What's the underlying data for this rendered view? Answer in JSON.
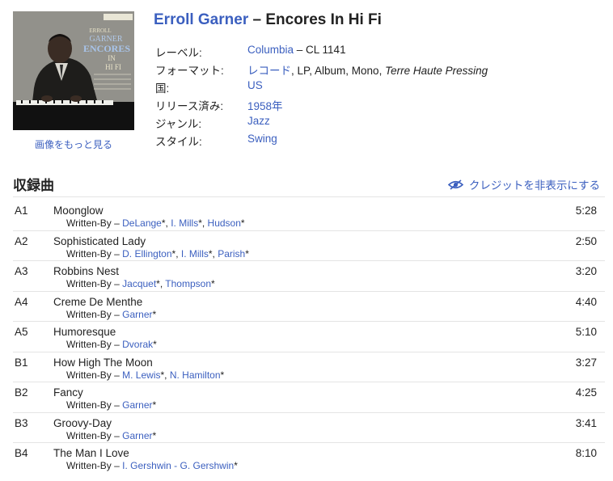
{
  "release": {
    "artist": "Erroll Garner",
    "separator": " – ",
    "album": "Encores In Hi Fi"
  },
  "cover": {
    "more_images": "画像をもっと見る",
    "text_lines": [
      "ERROLL",
      "GARNER",
      "ENCORES",
      "IN",
      "HI FI"
    ]
  },
  "info": {
    "label": {
      "label": "レーベル:",
      "link": "Columbia",
      "rest": " – CL 1141"
    },
    "format": {
      "label": "フォーマット:",
      "link": "レコード",
      "rest": ", LP, Album, Mono, ",
      "italic": "Terre Haute Pressing"
    },
    "country": {
      "label": "国:",
      "link": "US"
    },
    "released": {
      "label": "リリース済み:",
      "link": "1958年"
    },
    "genre": {
      "label": "ジャンル:",
      "link": "Jazz"
    },
    "style": {
      "label": "スタイル:",
      "link": "Swing"
    }
  },
  "tracklist": {
    "heading": "収録曲",
    "toggle_credits": "クレジットを非表示にする",
    "credit_prefix": "Written-By – ",
    "tracks": [
      {
        "pos": "A1",
        "title": "Moonglow",
        "writers": [
          "DeLange",
          "I. Mills",
          "Hudson"
        ],
        "duration": "5:28"
      },
      {
        "pos": "A2",
        "title": "Sophisticated Lady",
        "writers": [
          "D. Ellington",
          "I. Mills",
          "Parish"
        ],
        "duration": "2:50"
      },
      {
        "pos": "A3",
        "title": "Robbins Nest",
        "writers": [
          "Jacquet",
          "Thompson"
        ],
        "duration": "3:20"
      },
      {
        "pos": "A4",
        "title": "Creme De Menthe",
        "writers": [
          "Garner"
        ],
        "duration": "4:40"
      },
      {
        "pos": "A5",
        "title": "Humoresque",
        "writers": [
          "Dvorak"
        ],
        "duration": "5:10"
      },
      {
        "pos": "B1",
        "title": "How High The Moon",
        "writers": [
          "M. Lewis",
          "N. Hamilton"
        ],
        "duration": "3:27"
      },
      {
        "pos": "B2",
        "title": "Fancy",
        "writers": [
          "Garner"
        ],
        "duration": "4:25"
      },
      {
        "pos": "B3",
        "title": "Groovy-Day",
        "writers": [
          "Garner"
        ],
        "duration": "3:41"
      },
      {
        "pos": "B4",
        "title": "The Man I Love",
        "writers": [
          "I. Gershwin - G. Gershwin"
        ],
        "duration": "8:10"
      }
    ]
  },
  "colors": {
    "link": "#3b5fbf",
    "text": "#222222",
    "divider": "#e4e4e4"
  }
}
